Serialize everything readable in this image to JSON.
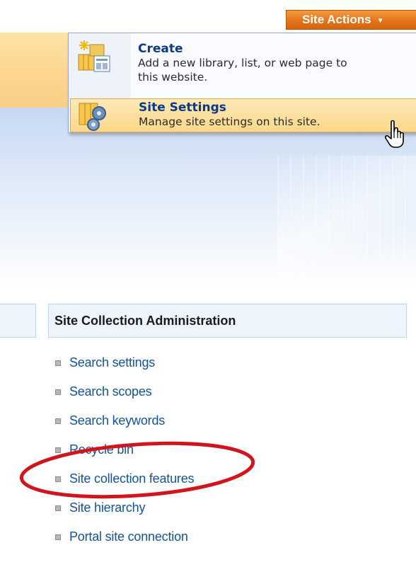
{
  "site_actions": {
    "label": "Site Actions",
    "caret": "▼"
  },
  "menu": {
    "items": [
      {
        "title": "Create",
        "description_line1": "Add a new library, list, or web page to",
        "description_line2": "this website.",
        "icon": "create-icon"
      },
      {
        "title": "Site Settings",
        "description": "Manage site settings on this site.",
        "icon": "site-settings-icon",
        "state": "hovered"
      }
    ]
  },
  "section": {
    "title": "Site Collection Administration",
    "links": [
      {
        "label": "Search settings"
      },
      {
        "label": "Search scopes"
      },
      {
        "label": "Search keywords"
      },
      {
        "label": "Recycle bin"
      },
      {
        "label": "Site collection features",
        "highlighted": true
      },
      {
        "label": "Site hierarchy"
      },
      {
        "label": "Portal site connection"
      }
    ]
  },
  "colors": {
    "accent_orange": "#e3741b",
    "link_blue": "#13539b",
    "highlight_red": "#d2141c",
    "menu_hover": "#fbd88a"
  }
}
